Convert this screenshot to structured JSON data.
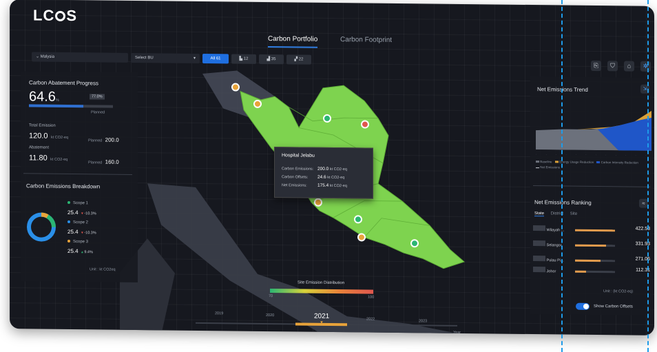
{
  "app": {
    "logo_left": "LC",
    "logo_right": "S"
  },
  "tabs": [
    {
      "label": "Carbon Portfolio"
    },
    {
      "label": "Carbon Footprint"
    }
  ],
  "filters": {
    "country": "Malysia",
    "bu": "Select BU",
    "chips": [
      "All 61",
      "12",
      "35",
      "22"
    ]
  },
  "abatement": {
    "title": "Carbon Abatement Progress",
    "value": "64.6",
    "unit": "%",
    "target": "77.0",
    "target_unit": "%",
    "planned_label": "Planned",
    "progress": 0.646
  },
  "total": {
    "label": "Total Emission",
    "value": "120.0",
    "unit": "kt CO2-eq",
    "planned_label": "Planned",
    "planned_value": "200.0"
  },
  "abatement_row": {
    "label": "Abatement",
    "value": "11.80",
    "unit": "kt CO2-eq",
    "planned_label": "Planned",
    "planned_value": "160.0"
  },
  "breakdown": {
    "title": "Carbon Emissions Breakdown",
    "unit": "Unit : kt CO2eq",
    "scopes": [
      {
        "name": "Scope 1",
        "value": "25.4",
        "change": "-10.3%",
        "color": "#2bb673"
      },
      {
        "name": "Scope 2",
        "value": "25.4",
        "change": "-10.3%",
        "color": "#2a8fe8"
      },
      {
        "name": "Scope 3",
        "value": "25.4",
        "change": "9.4%",
        "color": "#e8a33a"
      }
    ]
  },
  "tooltip": {
    "title": "Hospital Jelabu",
    "rows": [
      {
        "label": "Carbon Emissions:",
        "value": "200.0",
        "unit": "kt CO2-eq"
      },
      {
        "label": "Carbon Offsets:",
        "value": "24.6",
        "unit": "kt CO2-eq"
      },
      {
        "label": "Net Emissions:",
        "value": "175.4",
        "unit": "kt CO2-eq"
      }
    ]
  },
  "distribution": {
    "title": "Site Emission Distribution",
    "min": "70",
    "max": "100"
  },
  "timeline": {
    "years": [
      "2019",
      "2020",
      "2021",
      "2022",
      "2023"
    ],
    "selected": "2021",
    "axis_label": "Year"
  },
  "trend": {
    "title": "Net Emissions Trend",
    "legend": [
      "Baseline",
      "Energy Usage Reduction",
      "Carbon Intensity Reduction",
      "Net Emissions"
    ]
  },
  "ranking": {
    "title": "Net Emissions Ranking",
    "tabs": [
      "State",
      "District",
      "Site"
    ],
    "unit": "Unit : (kt CO2-eq)",
    "rows": [
      {
        "name": "Wilayah ...",
        "value": "422.58",
        "pct": 1.0
      },
      {
        "name": "Selangor",
        "value": "331.93",
        "pct": 0.78
      },
      {
        "name": "Pulau Pi...",
        "value": "271.06",
        "pct": 0.64
      },
      {
        "name": "Johor",
        "value": "112.31",
        "pct": 0.27
      }
    ]
  },
  "offsets_toggle": {
    "label": "Show Carbon Offsets",
    "on": true
  },
  "colors": {
    "accent": "#1f6fe0",
    "map": "#7ed34f",
    "guide": "#1e9be9"
  }
}
